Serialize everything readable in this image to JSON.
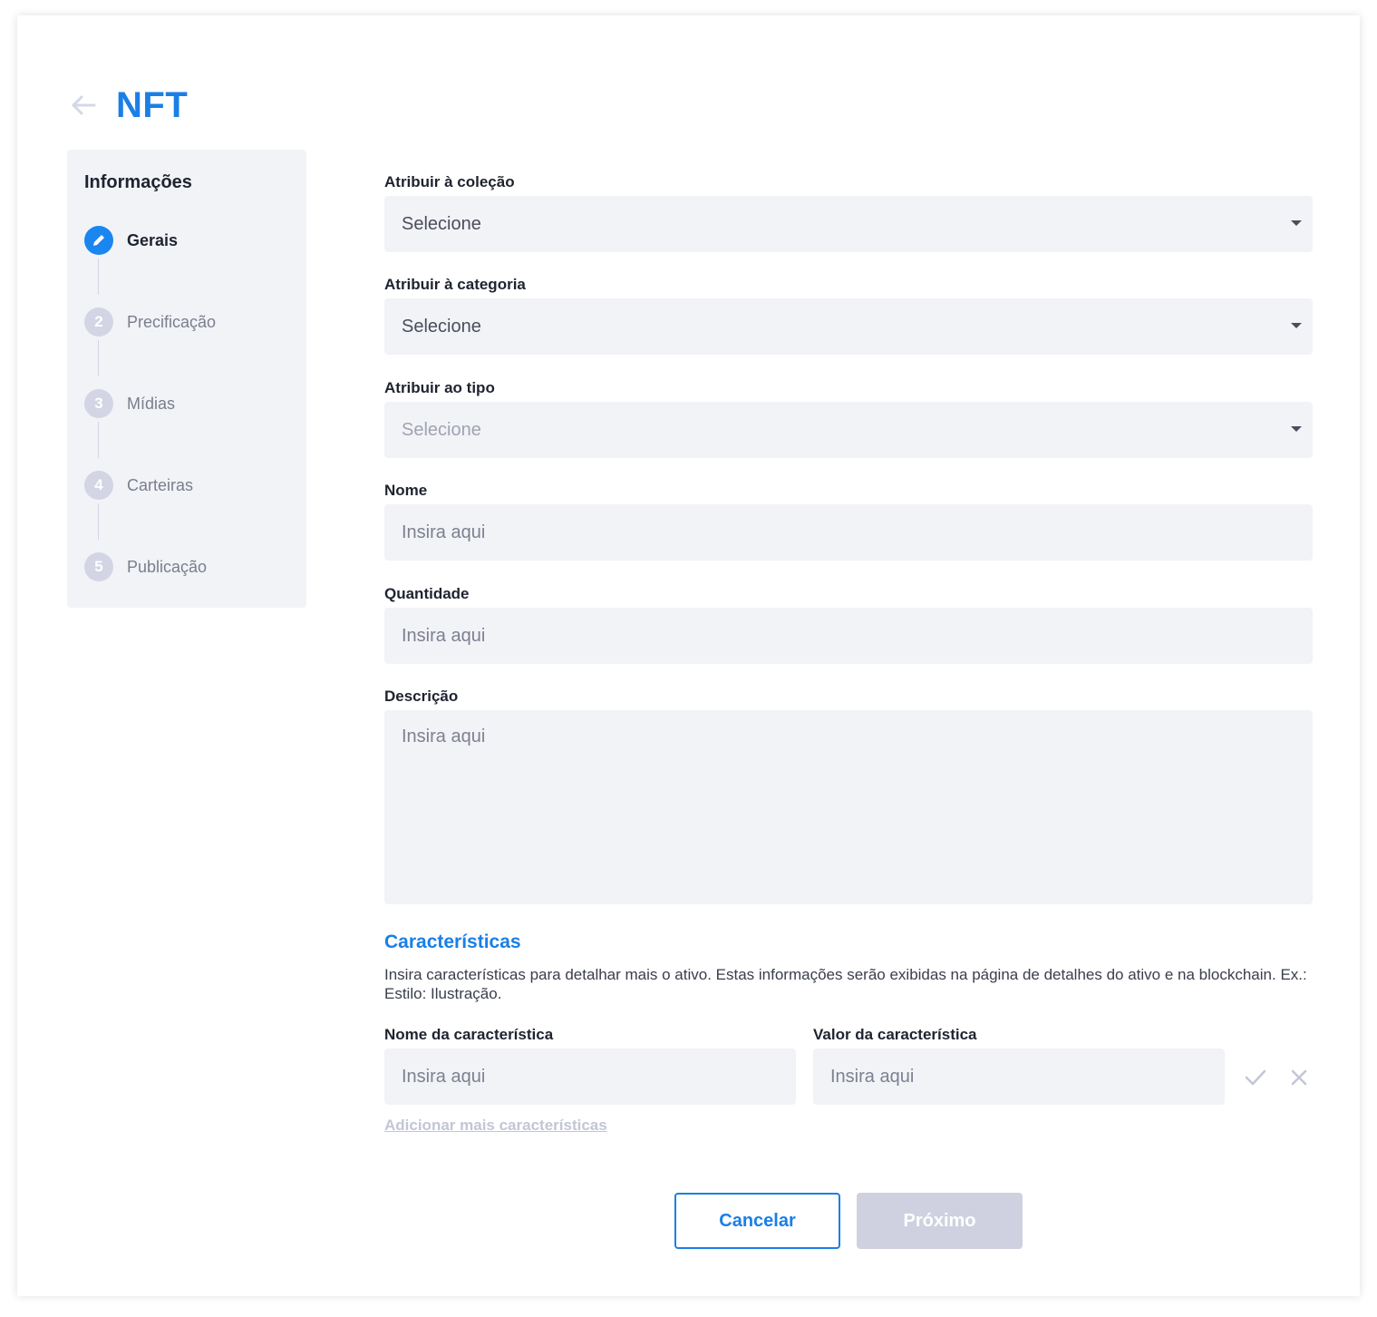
{
  "header": {
    "title": "NFT"
  },
  "steps": {
    "title": "Informações",
    "items": [
      {
        "number": "",
        "label": "Gerais"
      },
      {
        "number": "2",
        "label": "Precificação"
      },
      {
        "number": "3",
        "label": "Mídias"
      },
      {
        "number": "4",
        "label": "Carteiras"
      },
      {
        "number": "5",
        "label": "Publicação"
      }
    ]
  },
  "form": {
    "collection": {
      "label": "Atribuir à coleção",
      "value": "Selecione"
    },
    "category": {
      "label": "Atribuir à categoria",
      "value": "Selecione"
    },
    "type": {
      "label": "Atribuir ao tipo",
      "value": "Selecione"
    },
    "name": {
      "label": "Nome",
      "placeholder": "Insira aqui"
    },
    "quantity": {
      "label": "Quantidade",
      "placeholder": "Insira aqui"
    },
    "description": {
      "label": "Descrição",
      "placeholder": "Insira aqui"
    }
  },
  "characteristics": {
    "title": "Características",
    "description": "Insira características para detalhar mais o ativo. Estas informações serão exibidas na página de detalhes do ativo e na blockchain. Ex.: Estilo: Ilustração.",
    "name_label": "Nome da característica",
    "name_placeholder": "Insira aqui",
    "value_label": "Valor da característica",
    "value_placeholder": "Insira aqui",
    "add_more": "Adicionar mais características"
  },
  "actions": {
    "cancel": "Cancelar",
    "next": "Próximo"
  },
  "colors": {
    "accent": "#1a7fe6",
    "field_bg": "#f2f3f7",
    "disabled": "#cfd1e0"
  }
}
